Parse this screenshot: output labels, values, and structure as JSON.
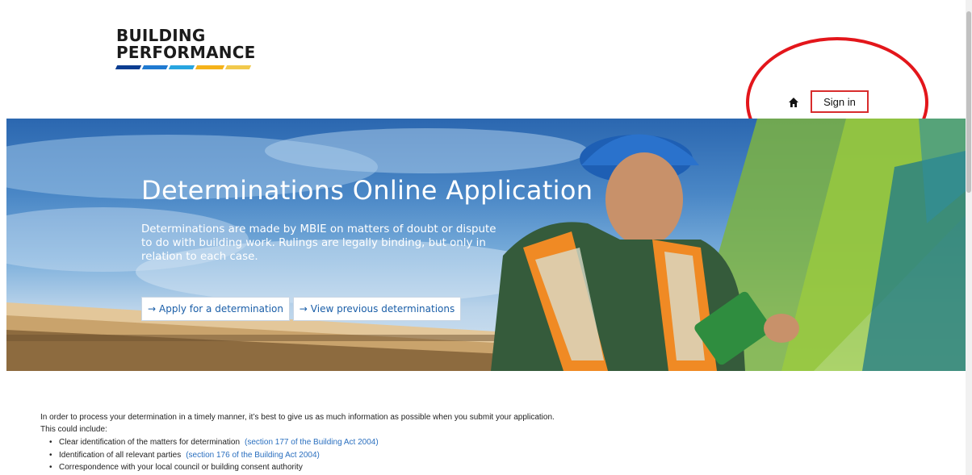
{
  "brand": {
    "logo_line1": "BUILDING",
    "logo_line2": "PERFORMANCE",
    "stripe_colors": [
      "#0b3d91",
      "#1f7ad1",
      "#28a5e0",
      "#f5b21a",
      "#f2c94c"
    ]
  },
  "nav": {
    "home_icon": "home-icon",
    "sign_in_label": "Sign in"
  },
  "hero": {
    "title": "Determinations Online Application",
    "description": "Determinations are made by MBIE on matters of doubt or dispute to do with building work. Rulings are legally binding, but only in relation to each case.",
    "apply_button": {
      "arrow": "→",
      "label": "Apply for a determination"
    },
    "view_button": {
      "arrow": "→",
      "label": "View previous determinations"
    }
  },
  "content": {
    "intro": "In order to process your determination in a timely manner, it’s best to give us as much information as possible when you submit your application.",
    "includes_label": "This could include:",
    "items": [
      {
        "text": "Clear identification of the matters for determination",
        "link": "(section 177 of the Building Act 2004)"
      },
      {
        "text": "Identification of all relevant parties",
        "link": "(section 176 of the Building Act 2004)"
      },
      {
        "text": "Correspondence with your local council or building consent authority",
        "link": ""
      }
    ]
  },
  "colors": {
    "annotation": "#e3161b",
    "sign_in_border": "#d82c2c",
    "link": "#2a6fbf"
  }
}
